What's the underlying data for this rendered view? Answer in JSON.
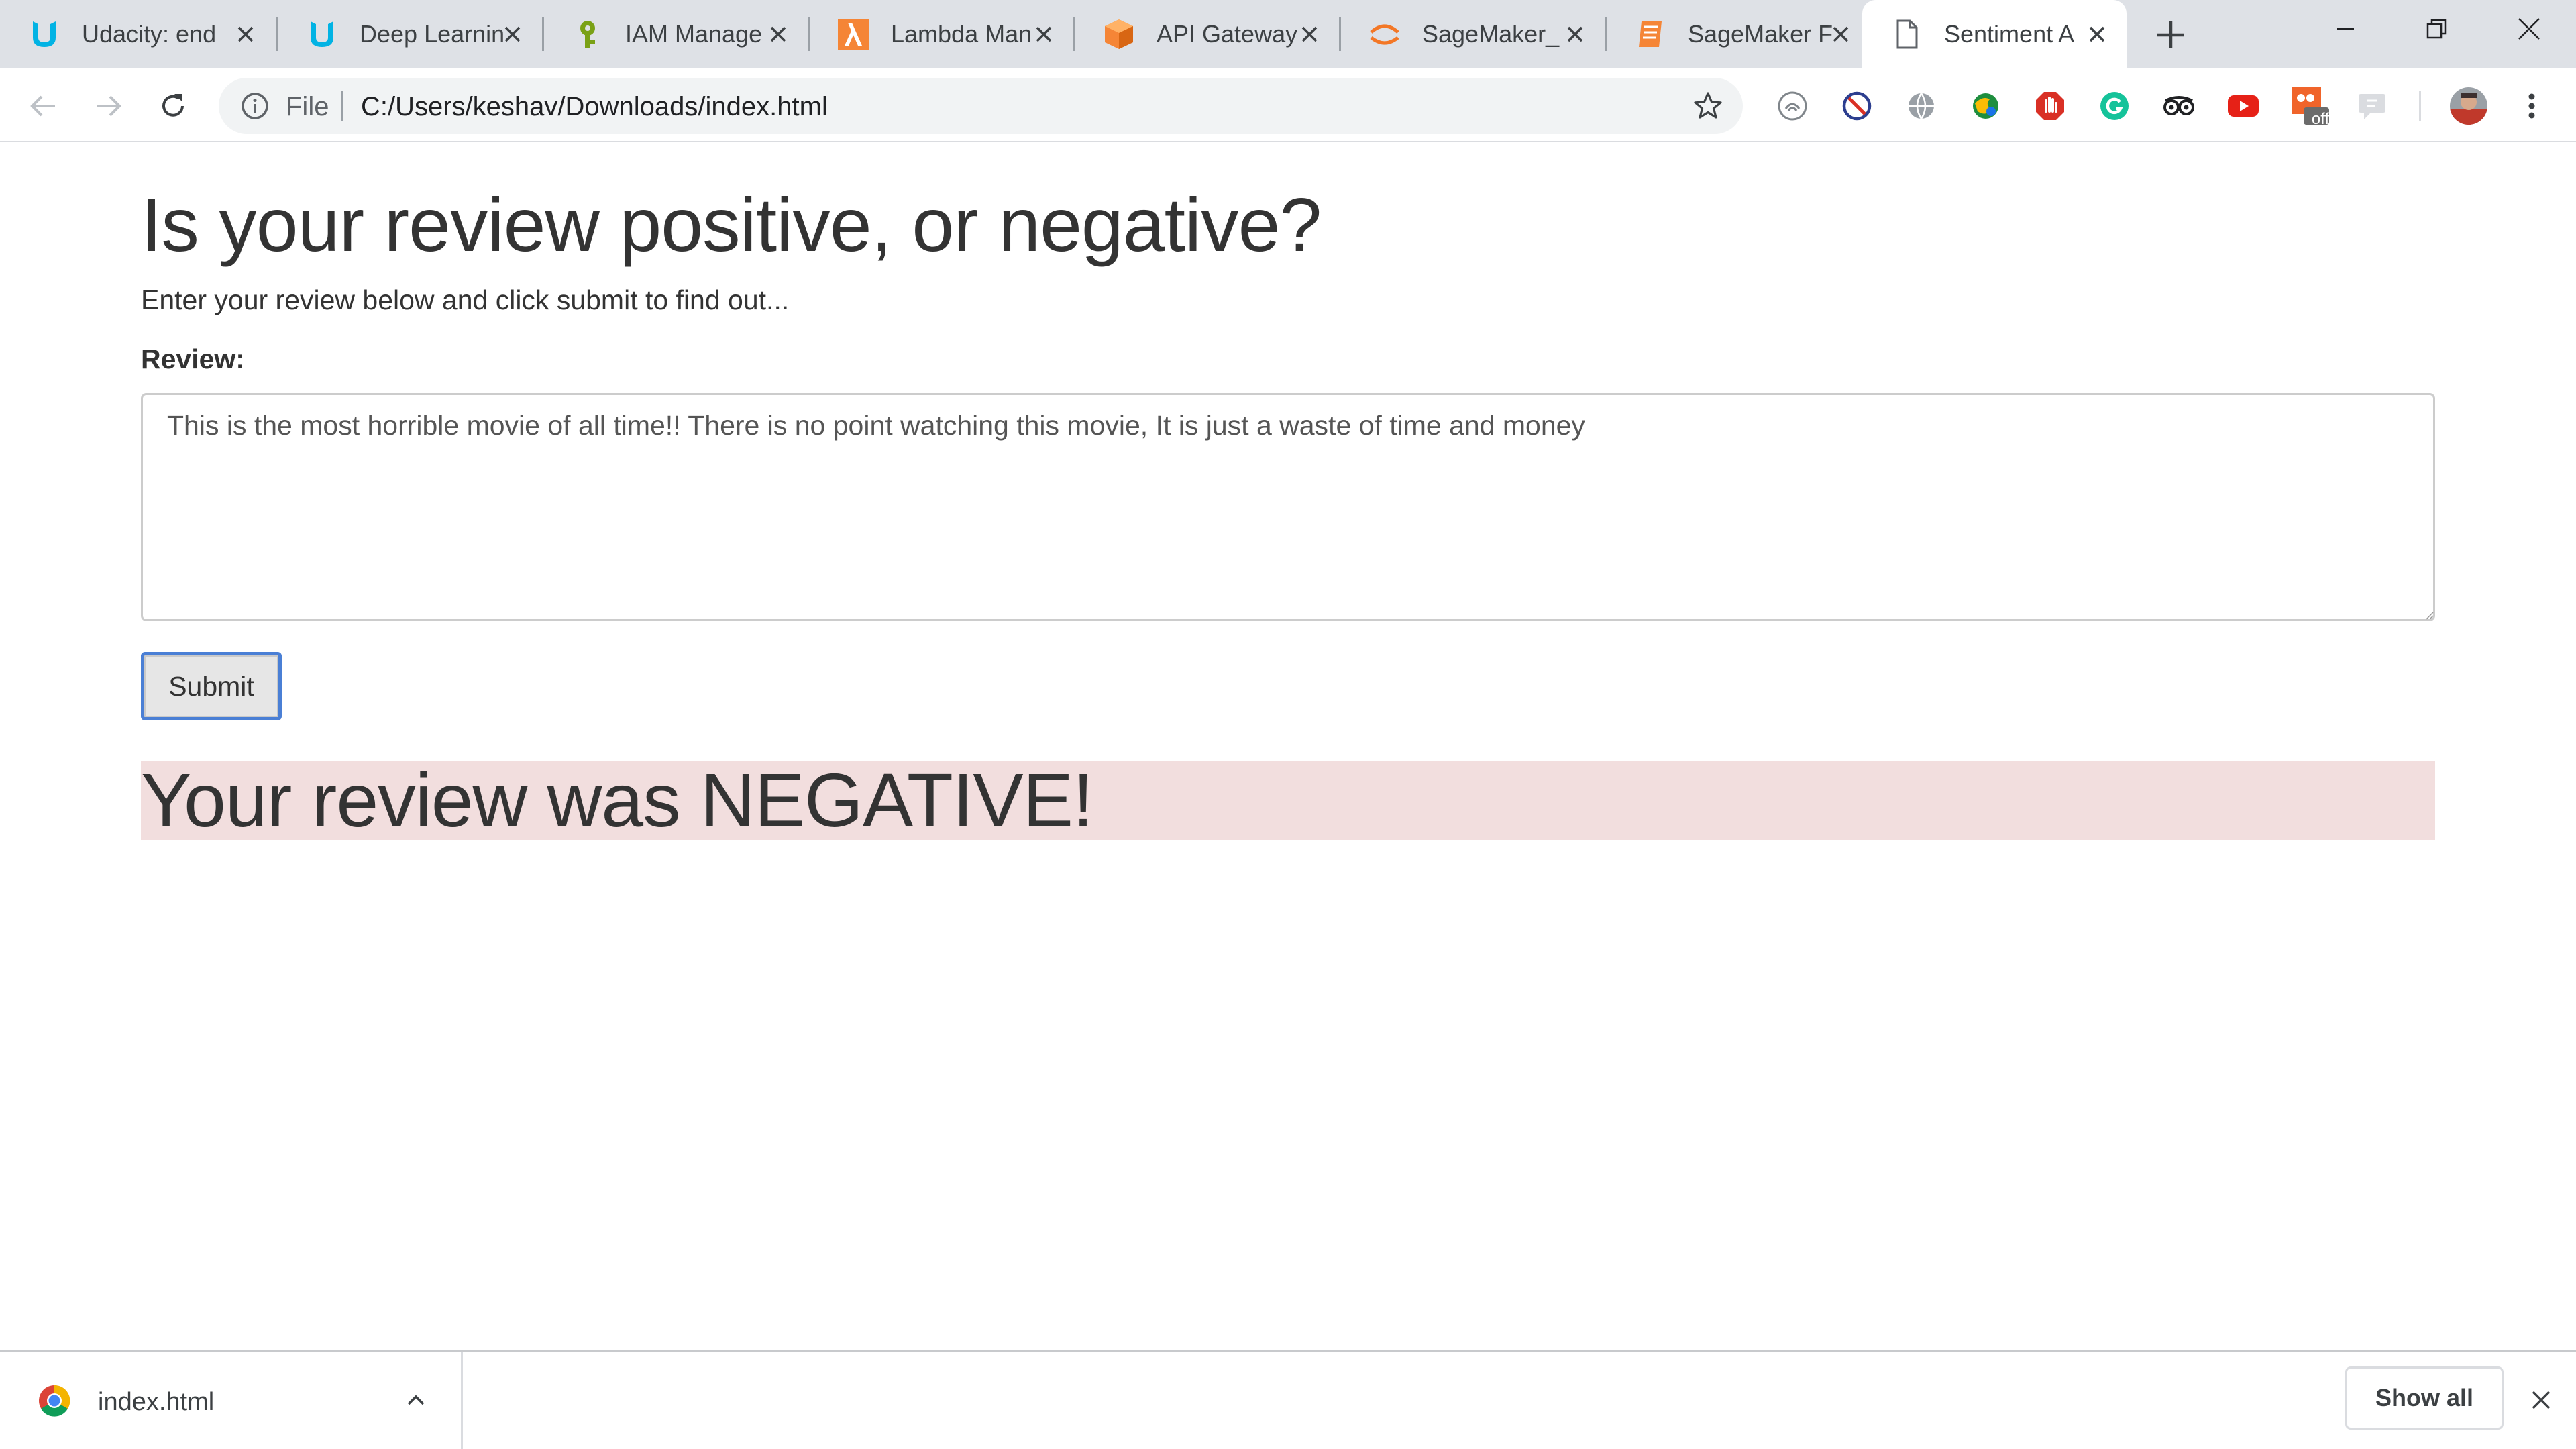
{
  "tabs": [
    {
      "title": "Udacity: end",
      "icon": "udacity-icon",
      "color": "#02b3e4"
    },
    {
      "title": "Deep Learnin",
      "icon": "udacity-icon",
      "color": "#02b3e4"
    },
    {
      "title": "IAM Manage",
      "icon": "iam-icon",
      "color": "#7aa116"
    },
    {
      "title": "Lambda Man",
      "icon": "lambda-icon",
      "color": "#ff9900"
    },
    {
      "title": "API Gateway",
      "icon": "aws-box-icon",
      "color": "#ff9900"
    },
    {
      "title": "SageMaker_",
      "icon": "jupyter-icon",
      "color": "#f37726"
    },
    {
      "title": "SageMaker F",
      "icon": "sagemaker-docs-icon",
      "color": "#ff9900"
    },
    {
      "title": "Sentiment A",
      "icon": "page-icon",
      "active": true
    }
  ],
  "omnibox": {
    "scheme": "File",
    "url": "C:/Users/keshav/Downloads/index.html"
  },
  "extension_badge": "off",
  "page": {
    "heading": "Is your review positive, or negative?",
    "lead": "Enter your review below and click submit to find out...",
    "review_label": "Review:",
    "review_text": "This is the most horrible movie of all time!! There is no point watching this movie, It is just a waste of time and money",
    "submit_label": "Submit",
    "result": "Your review was NEGATIVE!",
    "result_bg": "#f2dede"
  },
  "downloads": {
    "file_name": "index.html",
    "show_all": "Show all"
  }
}
